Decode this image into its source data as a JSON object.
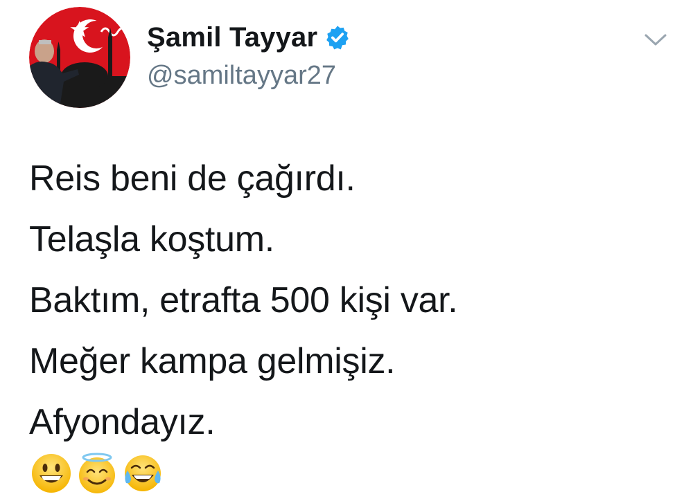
{
  "user": {
    "display_name": "Şamil Tayyar",
    "handle": "@samiltayyar27",
    "verified": true
  },
  "tweet": {
    "lines": [
      "Reis beni de çağırdı.",
      "Telaşla koştum.",
      "Baktım, etrafta 500 kişi var.",
      "Meğer kampa gelmişiz.",
      "Afyondayız."
    ],
    "emojis": [
      "grinning-face-emoji",
      "smiling-face-with-halo-emoji",
      "face-with-tears-of-joy-emoji"
    ]
  },
  "colors": {
    "text": "#14171a",
    "secondary": "#657786",
    "verified_blue": "#1da1f2",
    "avatar_red": "#d8141e"
  },
  "icons": {
    "verified": "verified-badge-icon",
    "caret": "chevron-down-icon"
  }
}
